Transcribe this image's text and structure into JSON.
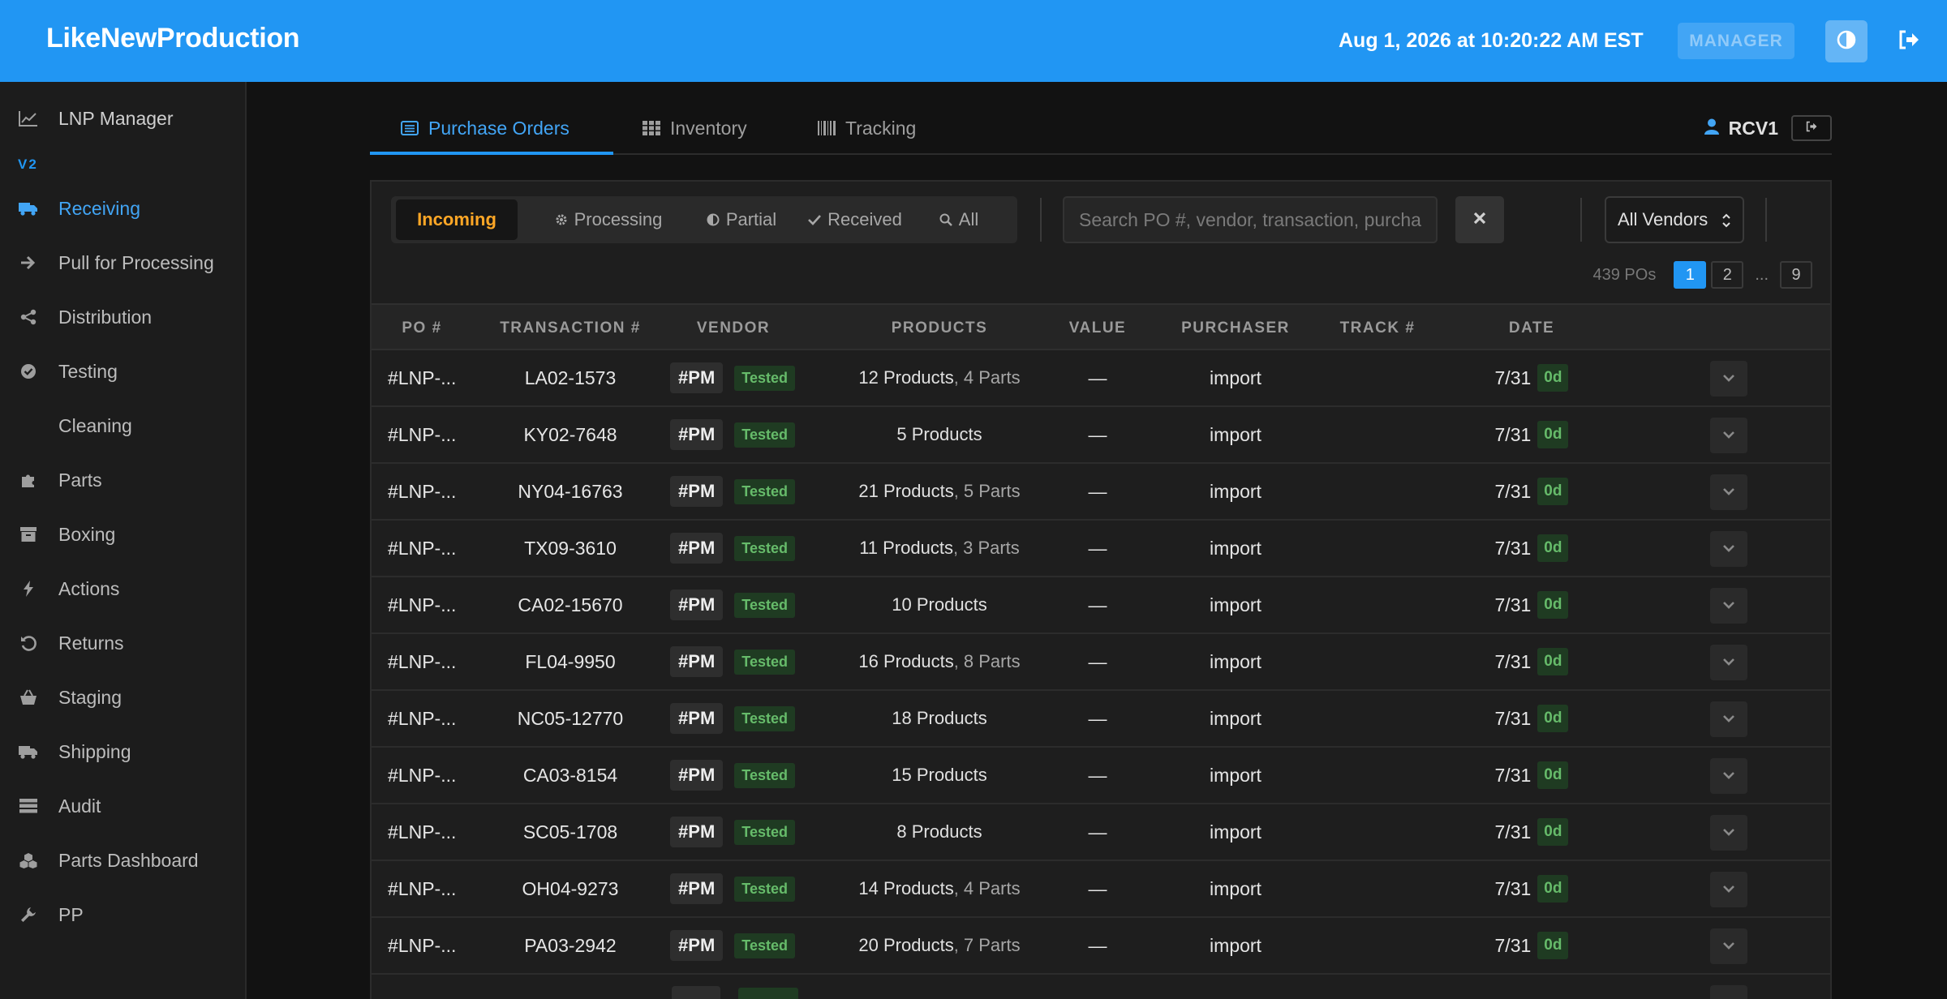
{
  "header": {
    "brand": "LikeNewProduction",
    "datetime": "Aug 1, 2026 at 10:20:22 AM EST",
    "role": "MANAGER",
    "theme_icon": "contrast-icon",
    "logout_icon": "sign-out-icon"
  },
  "sidebar": {
    "top_item": {
      "label": "LNP Manager",
      "icon": "line-chart-icon"
    },
    "version_label": "V2",
    "items": [
      {
        "label": "Receiving",
        "icon": "truck-icon",
        "active": true
      },
      {
        "label": "Pull for Processing",
        "icon": "arrow-right-icon"
      },
      {
        "label": "Distribution",
        "icon": "share-icon"
      },
      {
        "label": "Testing",
        "icon": "check-circle-icon"
      },
      {
        "label": "Cleaning",
        "icon": "droplet-icon"
      },
      {
        "label": "Parts",
        "icon": "puzzle-icon"
      },
      {
        "label": "Boxing",
        "icon": "archive-box-icon"
      },
      {
        "label": "Actions",
        "icon": "bolt-icon"
      },
      {
        "label": "Returns",
        "icon": "undo-icon"
      },
      {
        "label": "Staging",
        "icon": "basket-icon"
      },
      {
        "label": "Shipping",
        "icon": "truck-icon"
      },
      {
        "label": "Audit",
        "icon": "server-icon"
      },
      {
        "label": "Parts Dashboard",
        "icon": "cubes-icon"
      },
      {
        "label": "PP",
        "icon": "wrench-icon"
      }
    ]
  },
  "tabs": [
    {
      "label": "Purchase Orders",
      "icon": "list-alt-icon",
      "active": true
    },
    {
      "label": "Inventory",
      "icon": "grid-icon"
    },
    {
      "label": "Tracking",
      "icon": "barcode-icon"
    }
  ],
  "user": {
    "name": "RCV1",
    "icon": "user-icon"
  },
  "filters": [
    {
      "label": "Incoming",
      "active": true
    },
    {
      "label": "Processing",
      "icon": "gear-icon"
    },
    {
      "label": "Partial",
      "icon": "half-circle-icon"
    },
    {
      "label": "Received",
      "icon": "check-icon"
    },
    {
      "label": "All",
      "icon": "search-icon"
    }
  ],
  "search": {
    "placeholder": "Search PO #, vendor, transaction, purchaser...",
    "value": ""
  },
  "vendor_select": {
    "selected": "All Vendors"
  },
  "pagination": {
    "count": "439 POs",
    "pages": [
      "1",
      "2",
      "...",
      "9"
    ],
    "current": "1"
  },
  "table": {
    "columns": [
      "PO #",
      "TRANSACTION #",
      "VENDOR",
      "PRODUCTS",
      "VALUE",
      "PURCHASER",
      "TRACK #",
      "DATE"
    ],
    "rows": [
      {
        "po": "#LNP-...",
        "txn": "LA02-1573",
        "vendor": "#PM",
        "status": "Tested",
        "products": "12 Products",
        "parts": "4 Parts",
        "value": "—",
        "purchaser": "import",
        "track": "",
        "date": "7/31",
        "age": "0d"
      },
      {
        "po": "#LNP-...",
        "txn": "KY02-7648",
        "vendor": "#PM",
        "status": "Tested",
        "products": "5 Products",
        "parts": "",
        "value": "—",
        "purchaser": "import",
        "track": "",
        "date": "7/31",
        "age": "0d"
      },
      {
        "po": "#LNP-...",
        "txn": "NY04-16763",
        "vendor": "#PM",
        "status": "Tested",
        "products": "21 Products",
        "parts": "5 Parts",
        "value": "—",
        "purchaser": "import",
        "track": "",
        "date": "7/31",
        "age": "0d"
      },
      {
        "po": "#LNP-...",
        "txn": "TX09-3610",
        "vendor": "#PM",
        "status": "Tested",
        "products": "11 Products",
        "parts": "3 Parts",
        "value": "—",
        "purchaser": "import",
        "track": "",
        "date": "7/31",
        "age": "0d"
      },
      {
        "po": "#LNP-...",
        "txn": "CA02-15670",
        "vendor": "#PM",
        "status": "Tested",
        "products": "10 Products",
        "parts": "",
        "value": "—",
        "purchaser": "import",
        "track": "",
        "date": "7/31",
        "age": "0d"
      },
      {
        "po": "#LNP-...",
        "txn": "FL04-9950",
        "vendor": "#PM",
        "status": "Tested",
        "products": "16 Products",
        "parts": "8 Parts",
        "value": "—",
        "purchaser": "import",
        "track": "",
        "date": "7/31",
        "age": "0d"
      },
      {
        "po": "#LNP-...",
        "txn": "NC05-12770",
        "vendor": "#PM",
        "status": "Tested",
        "products": "18 Products",
        "parts": "",
        "value": "—",
        "purchaser": "import",
        "track": "",
        "date": "7/31",
        "age": "0d"
      },
      {
        "po": "#LNP-...",
        "txn": "CA03-8154",
        "vendor": "#PM",
        "status": "Tested",
        "products": "15 Products",
        "parts": "",
        "value": "—",
        "purchaser": "import",
        "track": "",
        "date": "7/31",
        "age": "0d"
      },
      {
        "po": "#LNP-...",
        "txn": "SC05-1708",
        "vendor": "#PM",
        "status": "Tested",
        "products": "8 Products",
        "parts": "",
        "value": "—",
        "purchaser": "import",
        "track": "",
        "date": "7/31",
        "age": "0d"
      },
      {
        "po": "#LNP-...",
        "txn": "OH04-9273",
        "vendor": "#PM",
        "status": "Tested",
        "products": "14 Products",
        "parts": "4 Parts",
        "value": "—",
        "purchaser": "import",
        "track": "",
        "date": "7/31",
        "age": "0d"
      },
      {
        "po": "#LNP-...",
        "txn": "PA03-2942",
        "vendor": "#PM",
        "status": "Tested",
        "products": "20 Products",
        "parts": "7 Parts",
        "value": "—",
        "purchaser": "import",
        "track": "",
        "date": "7/31",
        "age": "0d"
      }
    ]
  },
  "colors": {
    "accent": "#2196f3",
    "incoming": "#ffa726",
    "tested": "#66bb6a",
    "background": "#121212"
  }
}
